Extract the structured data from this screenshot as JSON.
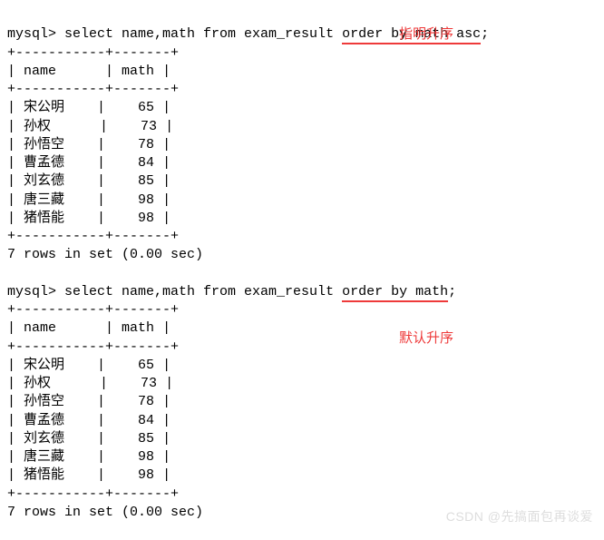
{
  "block1": {
    "prompt": "mysql> ",
    "query_prefix": "select name,math from exam_result ",
    "query_highlight": "order by math asc",
    "query_suffix": ";",
    "annotation": "指明升序",
    "header": {
      "name": "name",
      "math": "math"
    },
    "rows": [
      {
        "name": "宋公明",
        "math": "65"
      },
      {
        "name": "孙权",
        "math": "73"
      },
      {
        "name": "孙悟空",
        "math": "78"
      },
      {
        "name": "曹孟德",
        "math": "84"
      },
      {
        "name": "刘玄德",
        "math": "85"
      },
      {
        "name": "唐三藏",
        "math": "98"
      },
      {
        "name": "猪悟能",
        "math": "98"
      }
    ],
    "footer": "7 rows in set (0.00 sec)"
  },
  "block2": {
    "prompt": "mysql> ",
    "query_prefix": "select name,math from exam_result ",
    "query_highlight": "order by math",
    "query_suffix": ";",
    "annotation": "默认升序",
    "header": {
      "name": "name",
      "math": "math"
    },
    "rows": [
      {
        "name": "宋公明",
        "math": "65"
      },
      {
        "name": "孙权",
        "math": "73"
      },
      {
        "name": "孙悟空",
        "math": "78"
      },
      {
        "name": "曹孟德",
        "math": "84"
      },
      {
        "name": "刘玄德",
        "math": "85"
      },
      {
        "name": "唐三藏",
        "math": "98"
      },
      {
        "name": "猪悟能",
        "math": "98"
      }
    ],
    "footer": "7 rows in set (0.00 sec)"
  },
  "border": {
    "sep": "+-----------+-------+",
    "pipe": "|"
  },
  "watermark": "CSDN @先搞面包再谈爱",
  "chart_data": [
    {
      "type": "table",
      "title": "select name,math from exam_result order by math asc",
      "columns": [
        "name",
        "math"
      ],
      "rows": [
        [
          "宋公明",
          65
        ],
        [
          "孙权",
          73
        ],
        [
          "孙悟空",
          78
        ],
        [
          "曹孟德",
          84
        ],
        [
          "刘玄德",
          85
        ],
        [
          "唐三藏",
          98
        ],
        [
          "猪悟能",
          98
        ]
      ]
    },
    {
      "type": "table",
      "title": "select name,math from exam_result order by math",
      "columns": [
        "name",
        "math"
      ],
      "rows": [
        [
          "宋公明",
          65
        ],
        [
          "孙权",
          73
        ],
        [
          "孙悟空",
          78
        ],
        [
          "曹孟德",
          84
        ],
        [
          "刘玄德",
          85
        ],
        [
          "唐三藏",
          98
        ],
        [
          "猪悟能",
          98
        ]
      ]
    }
  ]
}
